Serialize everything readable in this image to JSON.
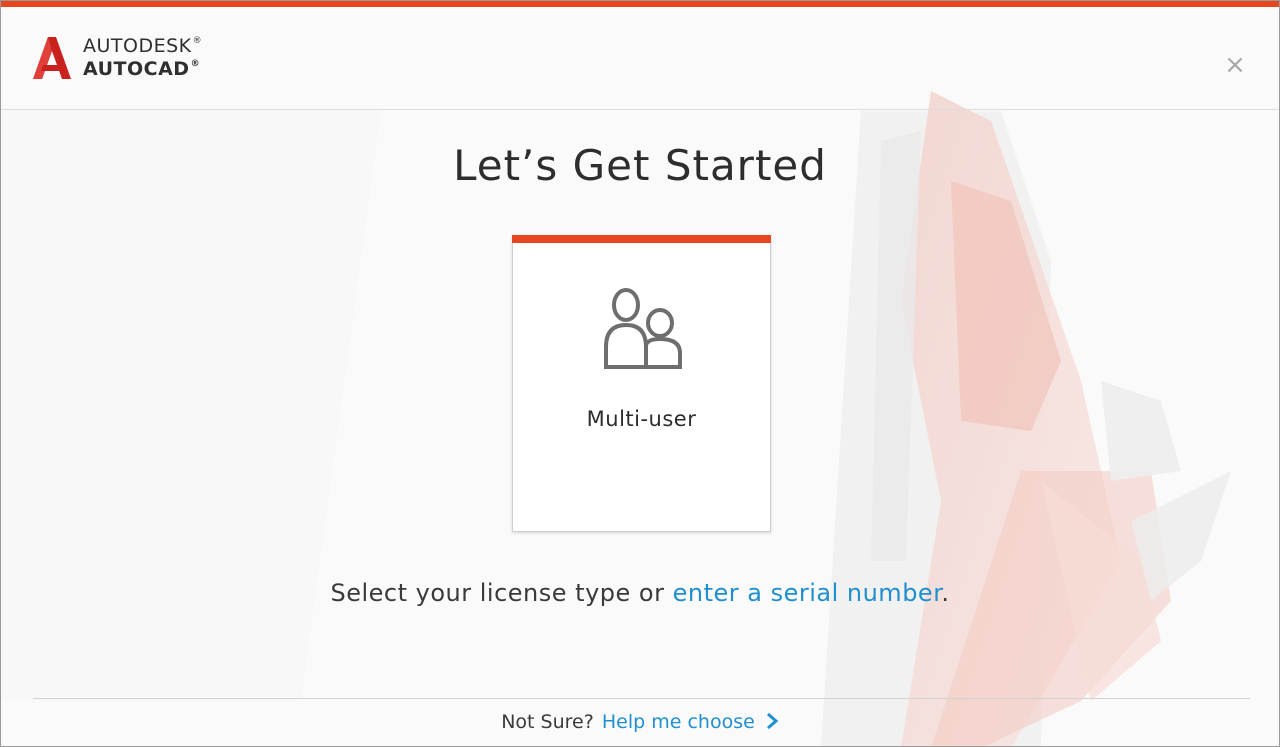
{
  "app": {
    "brand_line1": "AUTODESK",
    "brand_line2": "AUTOCAD",
    "registered_mark": "®"
  },
  "colors": {
    "accent": "#e8461e",
    "link": "#1f8fd0",
    "text": "#2d2d2d"
  },
  "dialog": {
    "close_icon": "×",
    "title": "Let’s Get Started"
  },
  "license_card": {
    "icon": "multi-user-icon",
    "label": "Multi-user"
  },
  "instruction": {
    "prefix": "Select your license type or ",
    "link_text": "enter a serial number",
    "suffix": "."
  },
  "footer": {
    "prompt": "Not Sure?",
    "link_text": "Help me choose",
    "chevron_icon": "chevron-right-icon"
  }
}
